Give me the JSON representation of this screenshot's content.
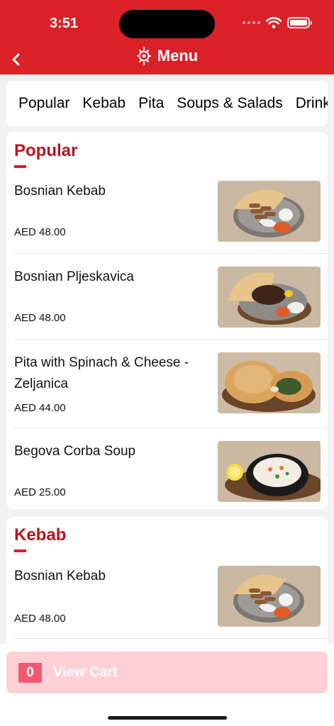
{
  "status": {
    "time": "3:51"
  },
  "header": {
    "title": "Menu",
    "back_icon": "chevron-left-icon",
    "logo_icon": "restaurant-logo-icon"
  },
  "tabs": [
    "Popular",
    "Kebab",
    "Pita",
    "Soups & Salads",
    "Drinks"
  ],
  "sections": {
    "popular": {
      "title": "Popular",
      "items": [
        {
          "name": "Bosnian Kebab",
          "price": "AED 48.00",
          "image": "kebab-plate"
        },
        {
          "name": "Bosnian Pljeskavica",
          "price": "AED 48.00",
          "image": "pljeskavica-plate"
        },
        {
          "name": "Pita with Spinach & Cheese - Zeljanica",
          "price": "AED 44.00",
          "image": "spinach-pita"
        },
        {
          "name": "Begova Corba Soup",
          "price": "AED 25.00",
          "image": "soup-bowl"
        }
      ]
    },
    "kebab": {
      "title": "Kebab",
      "items": [
        {
          "name": "Bosnian Kebab",
          "price": "AED 48.00",
          "image": "kebab-plate"
        }
      ]
    }
  },
  "cart": {
    "count": "0",
    "label": "View Cart"
  },
  "colors": {
    "brand": "#da2128",
    "section_title": "#b8141c",
    "cart_bg": "#fdd0d6",
    "cart_badge": "#f25a73"
  }
}
